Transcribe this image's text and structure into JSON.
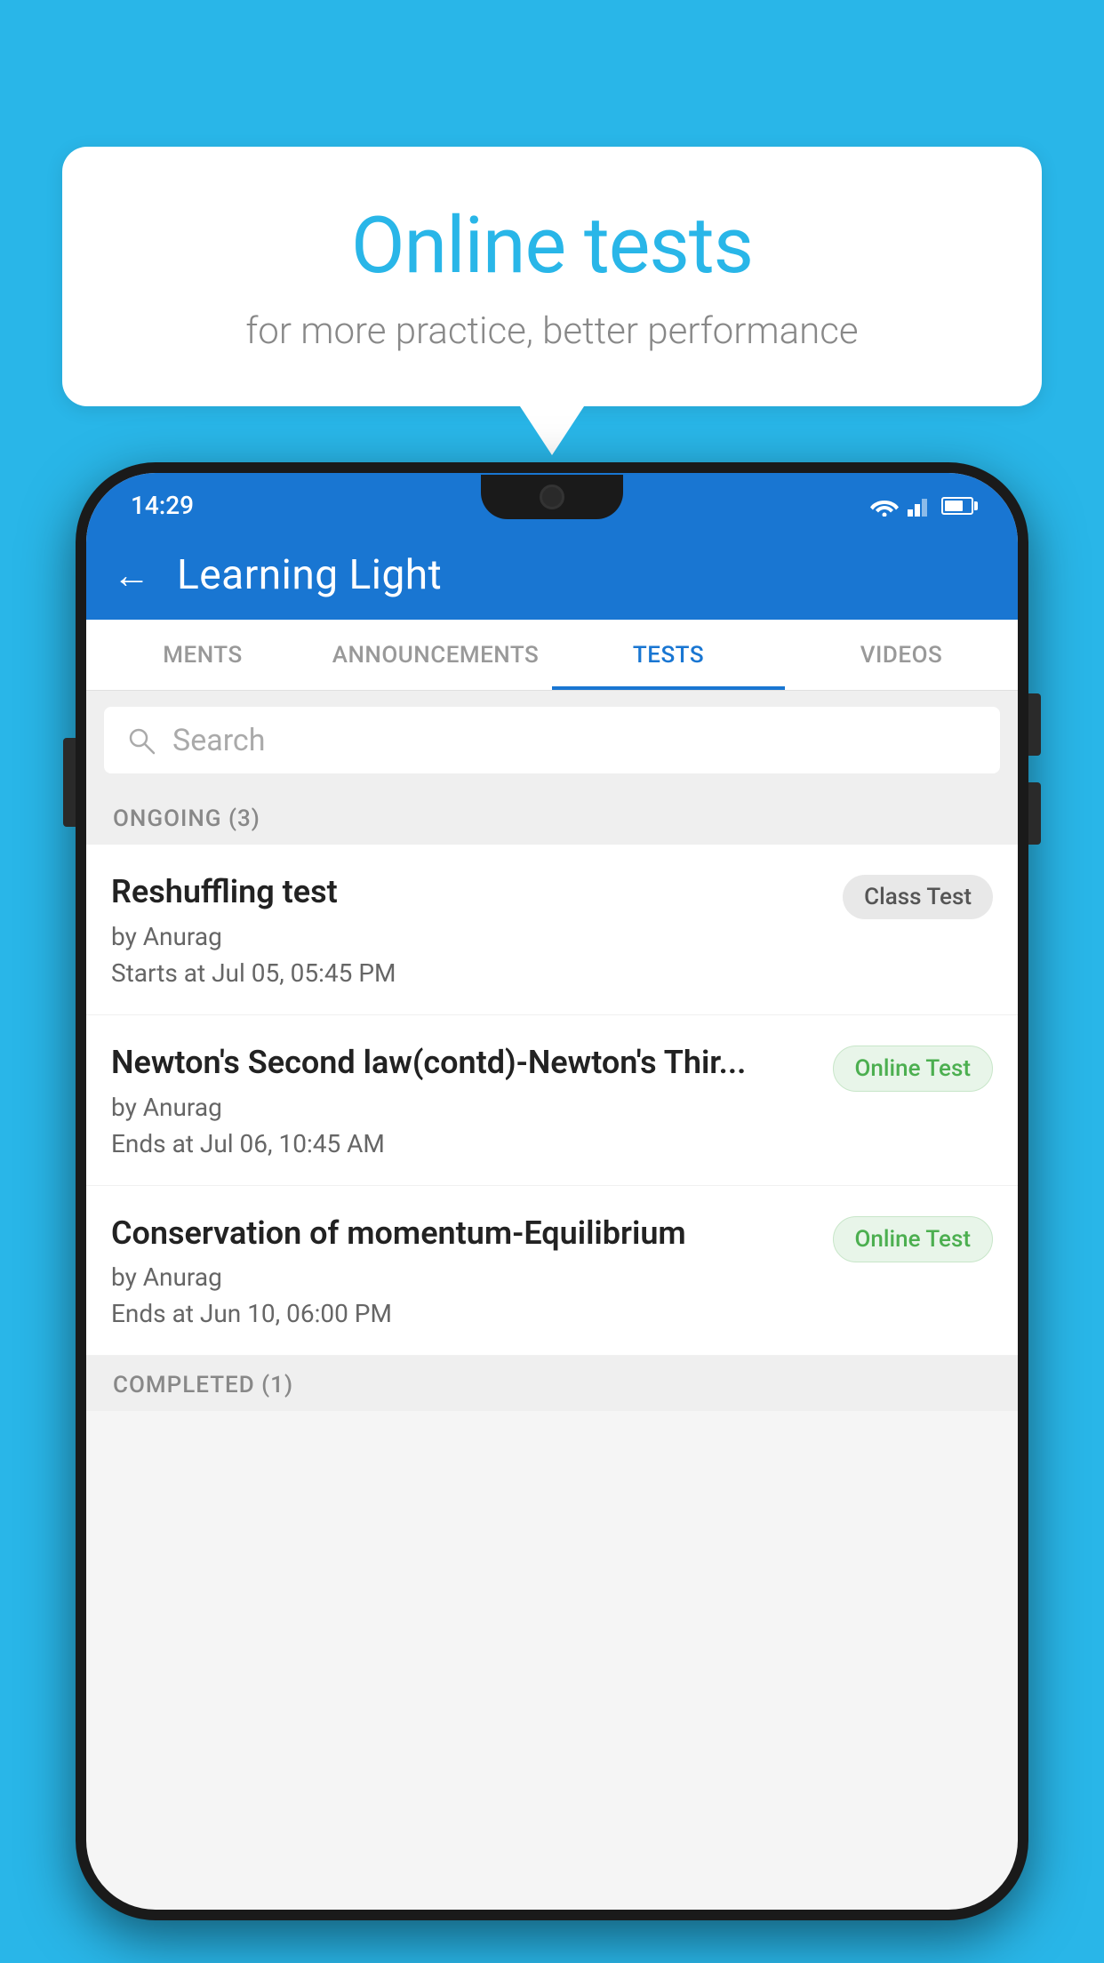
{
  "background_color": "#29B6E8",
  "bubble": {
    "title": "Online tests",
    "subtitle": "for more practice, better performance"
  },
  "phone": {
    "status_bar": {
      "time": "14:29",
      "wifi": "wifi",
      "signal": "signal",
      "battery": "battery"
    },
    "toolbar": {
      "back_label": "←",
      "title": "Learning Light"
    },
    "tabs": [
      {
        "label": "MENTS",
        "active": false
      },
      {
        "label": "ANNOUNCEMENTS",
        "active": false
      },
      {
        "label": "TESTS",
        "active": true
      },
      {
        "label": "VIDEOS",
        "active": false
      }
    ],
    "search": {
      "placeholder": "Search"
    },
    "section_ongoing": {
      "label": "ONGOING (3)"
    },
    "tests": [
      {
        "title": "Reshuffling test",
        "by": "by Anurag",
        "time": "Starts at  Jul 05, 05:45 PM",
        "badge": "Class Test",
        "badge_type": "class"
      },
      {
        "title": "Newton's Second law(contd)-Newton's Thir...",
        "by": "by Anurag",
        "time": "Ends at  Jul 06, 10:45 AM",
        "badge": "Online Test",
        "badge_type": "online"
      },
      {
        "title": "Conservation of momentum-Equilibrium",
        "by": "by Anurag",
        "time": "Ends at  Jun 10, 06:00 PM",
        "badge": "Online Test",
        "badge_type": "online"
      }
    ],
    "section_completed": {
      "label": "COMPLETED (1)"
    }
  }
}
